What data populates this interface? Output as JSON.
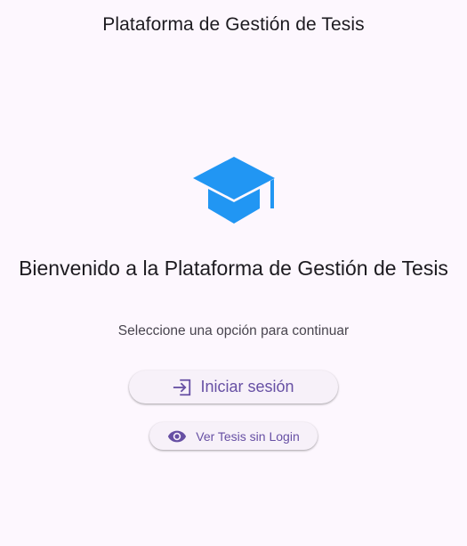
{
  "app_bar": {
    "title": "Plataforma de Gestión de Tesis"
  },
  "main": {
    "logo_icon": "graduation-cap-icon",
    "heading": "Bienvenido a la Plataforma de Gestión de Tesis",
    "subtitle": "Seleccione una opción para continuar",
    "login_button": {
      "icon": "login-icon",
      "label": "Iniciar sesión"
    },
    "guest_button": {
      "icon": "eye-icon",
      "label": "Ver Tesis sin Login"
    }
  },
  "colors": {
    "background": "#fdf7fe",
    "accent": "#6750a4",
    "logo": "#2196f3",
    "button_surface": "#f7f1f9"
  }
}
